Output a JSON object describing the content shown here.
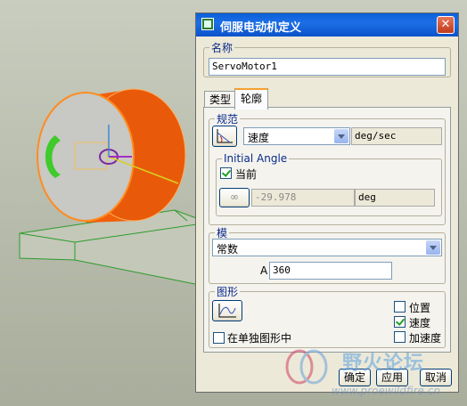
{
  "dialog": {
    "title": "伺服电动机定义",
    "close_label": "✕",
    "name_group": {
      "legend": "名称",
      "value": "ServoMotor1"
    },
    "tabs": [
      {
        "label": "类型"
      },
      {
        "label": "轮廓"
      }
    ],
    "spec": {
      "legend": "规范",
      "type_value": "速度",
      "unit": "deg/sec",
      "initial_angle": {
        "legend": "Initial Angle",
        "current_label": "当前",
        "current_checked": true,
        "value": "-29.978",
        "unit": "deg"
      }
    },
    "model": {
      "legend": "模",
      "type_value": "常数",
      "a_label": "A",
      "a_value": "360"
    },
    "graph": {
      "legend": "图形",
      "separate_label": "在单独图形中",
      "separate_checked": false,
      "options": [
        {
          "label": "位置",
          "checked": false
        },
        {
          "label": "速度",
          "checked": true
        },
        {
          "label": "加速度",
          "checked": false
        }
      ]
    },
    "buttons": {
      "ok": "确定",
      "apply": "应用",
      "cancel": "取消"
    }
  },
  "watermark": {
    "text": "野火论坛",
    "url": "www.proewildfire.cn"
  },
  "colors": {
    "title_blue": "#0a5fd7",
    "cylinder_orange": "#f25f0a",
    "face_gray": "#c8c8c4"
  }
}
